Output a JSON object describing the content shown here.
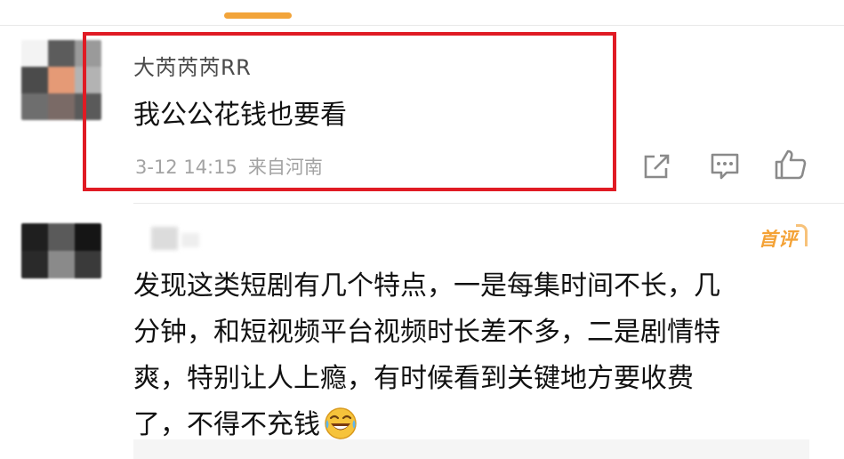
{
  "tab_indicator_color": "#f2a43a",
  "comment": {
    "username": "大芮芮芮RR",
    "text": "我公公花钱也要看",
    "time": "3-12 14:15",
    "location": "来自河南",
    "highlight_color": "#e01b24",
    "actions": [
      "share-icon",
      "comment-icon",
      "like-icon"
    ]
  },
  "reply": {
    "badge": "首评",
    "badge_color": "#f4a236",
    "text": "发现这类短剧有几个特点，一是每集时间不长，几\n分钟，和短视频平台视频时长差不多，二是剧情特\n爽，特别让人上瘾，有时候看到关键地方要收费\n了，不得不充钱",
    "emoji": "laughing-crying-emoji"
  }
}
